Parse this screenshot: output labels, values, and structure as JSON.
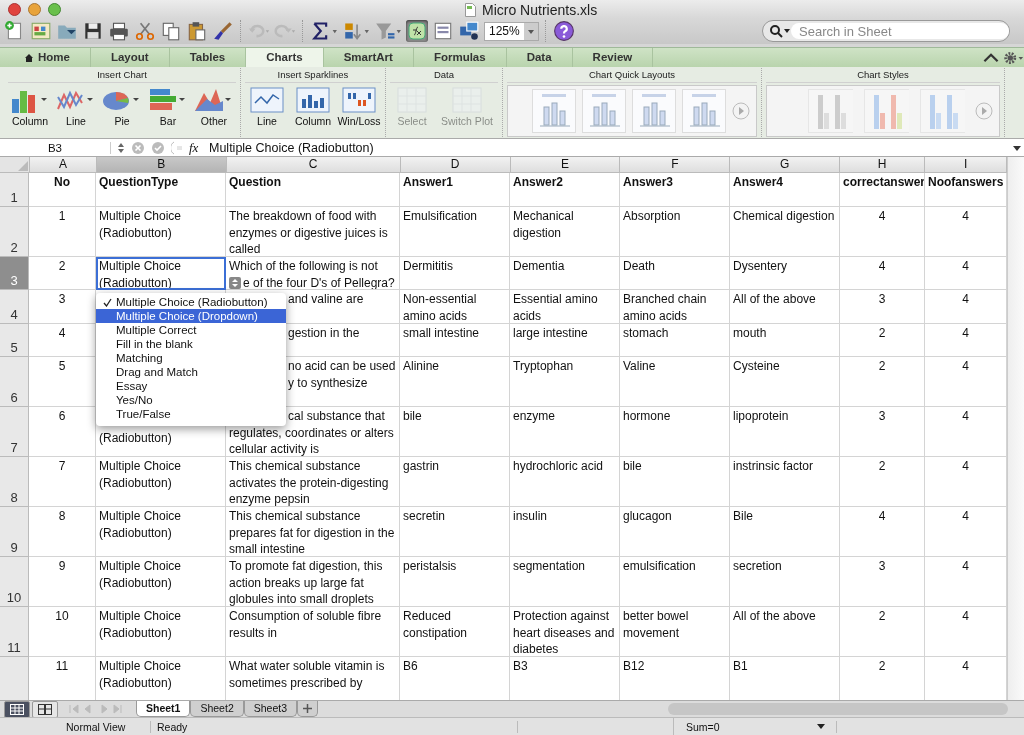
{
  "window": {
    "title": "Micro Nutrients.xls"
  },
  "toolbar": {
    "formula_builder_on": true,
    "zoom": "125%",
    "search_placeholder": "Search in Sheet"
  },
  "ribbon": {
    "tabs": [
      {
        "label": "Home",
        "selected": false
      },
      {
        "label": "Layout",
        "selected": false
      },
      {
        "label": "Tables",
        "selected": false
      },
      {
        "label": "Charts",
        "selected": true
      },
      {
        "label": "SmartArt",
        "selected": false
      },
      {
        "label": "Formulas",
        "selected": false
      },
      {
        "label": "Data",
        "selected": false
      },
      {
        "label": "Review",
        "selected": false
      }
    ],
    "groups": [
      {
        "title": "Insert Chart",
        "kind": "charts",
        "items": [
          {
            "label": "Column",
            "disabled": false
          },
          {
            "label": "Line",
            "disabled": false
          },
          {
            "label": "Pie",
            "disabled": false
          },
          {
            "label": "Bar",
            "disabled": false
          },
          {
            "label": "Other",
            "disabled": false
          }
        ]
      },
      {
        "title": "Insert Sparklines",
        "kind": "sparklines",
        "items": [
          {
            "label": "Line",
            "disabled": false
          },
          {
            "label": "Column",
            "disabled": false
          },
          {
            "label": "Win/Loss",
            "disabled": false
          }
        ]
      },
      {
        "title": "Data",
        "kind": "data",
        "items": [
          {
            "label": "Select",
            "disabled": true
          },
          {
            "label": "Switch Plot",
            "disabled": true
          }
        ]
      },
      {
        "title": "Chart Quick Layouts",
        "kind": "layouts"
      },
      {
        "title": "Chart Styles",
        "kind": "styles"
      }
    ]
  },
  "formula_bar": {
    "name_box": "B3",
    "fx_label": "fx",
    "value": "Multiple Choice (Radiobutton)"
  },
  "sheet": {
    "columns": [
      {
        "label": "A",
        "selected": false
      },
      {
        "label": "B",
        "selected": true
      },
      {
        "label": "C",
        "selected": false
      },
      {
        "label": "D",
        "selected": false
      },
      {
        "label": "E",
        "selected": false
      },
      {
        "label": "F",
        "selected": false
      },
      {
        "label": "G",
        "selected": false
      },
      {
        "label": "H",
        "selected": false
      },
      {
        "label": "I",
        "selected": false
      }
    ],
    "rows": [
      {
        "number": "1",
        "selected": false,
        "cells": [
          "No",
          "QuestionType",
          "Question",
          "Answer1",
          "Answer2",
          "Answer3",
          "Answer4",
          "correctanswer",
          "Noofanswers"
        ]
      },
      {
        "number": "2",
        "selected": false,
        "cells": [
          "1",
          "Multiple Choice\n(Radiobutton)",
          "The breakdown of food with\nenzymes or digestive juices is\ncalled",
          "Emulsification",
          "Mechanical\ndigestion",
          "Absorption",
          "Chemical digestion",
          "4",
          "4"
        ]
      },
      {
        "number": "3",
        "selected": true,
        "cells": [
          "2",
          {
            "text": "Multiple Choice\n(Radiobutton)",
            "active": true
          },
          "Which of the following is not\ne of the four D's of Pellegra?",
          "Dermititis",
          "Dementia",
          "Death",
          "Dysentery",
          "4",
          "4"
        ]
      },
      {
        "number": "4",
        "selected": false,
        "cells": [
          "3",
          null,
          "and valine are",
          "Non-essential\namino acids",
          "Essential amino\nacids",
          "Branched chain\namino acids",
          "All of the above",
          "3",
          "4"
        ]
      },
      {
        "number": "5",
        "selected": false,
        "cells": [
          "4",
          null,
          "gestion in the",
          "small intestine",
          "large intestine",
          "stomach",
          "mouth",
          "2",
          "4"
        ]
      },
      {
        "number": "6",
        "selected": false,
        "cells": [
          "5",
          null,
          "no acid can be used\ny to synthesize",
          "Alinine",
          "Tryptophan",
          "Valine",
          "Cysteine",
          "2",
          "4"
        ]
      },
      {
        "number": "7",
        "selected": false,
        "cells": [
          "6",
          "(Radiobutton)",
          "cal substance that\nregulates, coordinates or alters\ncellular activity is",
          "bile",
          "enzyme",
          "hormone",
          "lipoprotein",
          "3",
          "4"
        ]
      },
      {
        "number": "8",
        "selected": false,
        "cells": [
          "7",
          "Multiple Choice\n(Radiobutton)",
          "This chemical substance\nactivates the protein-digesting\nenzyme pepsin",
          "gastrin",
          "hydrochloric acid",
          "bile",
          "instrinsic factor",
          "2",
          "4"
        ]
      },
      {
        "number": "9",
        "selected": false,
        "cells": [
          "8",
          "Multiple Choice\n(Radiobutton)",
          "This chemical substance\nprepares fat for digestion in the\nsmall intestine",
          "secretin",
          "insulin",
          "glucagon",
          "Bile",
          "4",
          "4"
        ]
      },
      {
        "number": "10",
        "selected": false,
        "cells": [
          "9",
          "Multiple Choice\n(Radiobutton)",
          "To promote fat digestion, this\naction breaks up large fat\nglobules into small droplets",
          "peristalsis",
          "segmentation",
          "emulsification",
          "secretion",
          "3",
          "4"
        ]
      },
      {
        "number": "11",
        "selected": false,
        "cells": [
          "10",
          "Multiple Choice\n(Radiobutton)",
          "Consumption of soluble fibre\nresults in",
          "Reduced\nconstipation",
          "Protection against\nheart diseases and\ndiabetes",
          "better bowel\nmovement",
          "All of the above",
          "2",
          "4"
        ]
      },
      {
        "selected": false,
        "cells": [
          "11",
          "Multiple Choice\n(Radiobutton)",
          "What water soluble vitamin is\nsometimes prescribed by",
          "B6",
          "B3",
          "B12",
          "B1",
          "2",
          "4"
        ]
      }
    ]
  },
  "dropdown": {
    "items": [
      {
        "label": "Multiple Choice (Radiobutton)",
        "checked": true,
        "selected": false
      },
      {
        "label": "Multiple Choice (Dropdown)",
        "checked": false,
        "selected": true
      },
      {
        "label": "Multiple Correct",
        "checked": false,
        "selected": false
      },
      {
        "label": "Fill in the blank",
        "checked": false,
        "selected": false
      },
      {
        "label": "Matching",
        "checked": false,
        "selected": false
      },
      {
        "label": "Drag and Match",
        "checked": false,
        "selected": false
      },
      {
        "label": "Essay",
        "checked": false,
        "selected": false
      },
      {
        "label": "Yes/No",
        "checked": false,
        "selected": false
      },
      {
        "label": "True/False",
        "checked": false,
        "selected": false
      }
    ]
  },
  "view_buttons": [
    {
      "kind": "normal",
      "selected": true
    },
    {
      "kind": "page_layout",
      "selected": false
    }
  ],
  "sheet_tabs": [
    {
      "label": "Sheet1",
      "selected": true
    },
    {
      "label": "Sheet2",
      "selected": false
    },
    {
      "label": "Sheet3",
      "selected": false
    }
  ],
  "status_bar": {
    "view": "Normal View",
    "mode": "Ready",
    "sum": "Sum=0"
  }
}
